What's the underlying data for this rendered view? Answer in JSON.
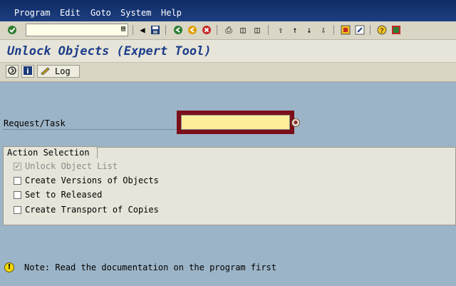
{
  "menu": {
    "items": [
      "Program",
      "Edit",
      "Goto",
      "System",
      "Help"
    ]
  },
  "toolbar": {
    "command_field_value": "",
    "icons": [
      "enter-icon",
      "save-icon",
      "back-icon",
      "exit-icon",
      "cancel-icon",
      "print-icon",
      "find-icon",
      "find-next-icon",
      "first-page-icon",
      "prev-page-icon",
      "next-page-icon",
      "last-page-icon",
      "create-session-icon",
      "shortcut-icon",
      "help-icon",
      "layout-icon"
    ]
  },
  "title": "Unlock Objects (Expert Tool)",
  "app_toolbar": {
    "log_label": "Log"
  },
  "form": {
    "request_label": "Request/Task",
    "request_value": ""
  },
  "action_selection": {
    "title": "Action Selection",
    "options": [
      {
        "label": "Unlock Object List",
        "checked": true,
        "disabled": true
      },
      {
        "label": "Create Versions of Objects",
        "checked": false,
        "disabled": false
      },
      {
        "label": "Set to Released",
        "checked": false,
        "disabled": false
      },
      {
        "label": "Create Transport of Copies",
        "checked": false,
        "disabled": false
      }
    ]
  },
  "status": {
    "note": "Note: Read the documentation on the program first"
  }
}
